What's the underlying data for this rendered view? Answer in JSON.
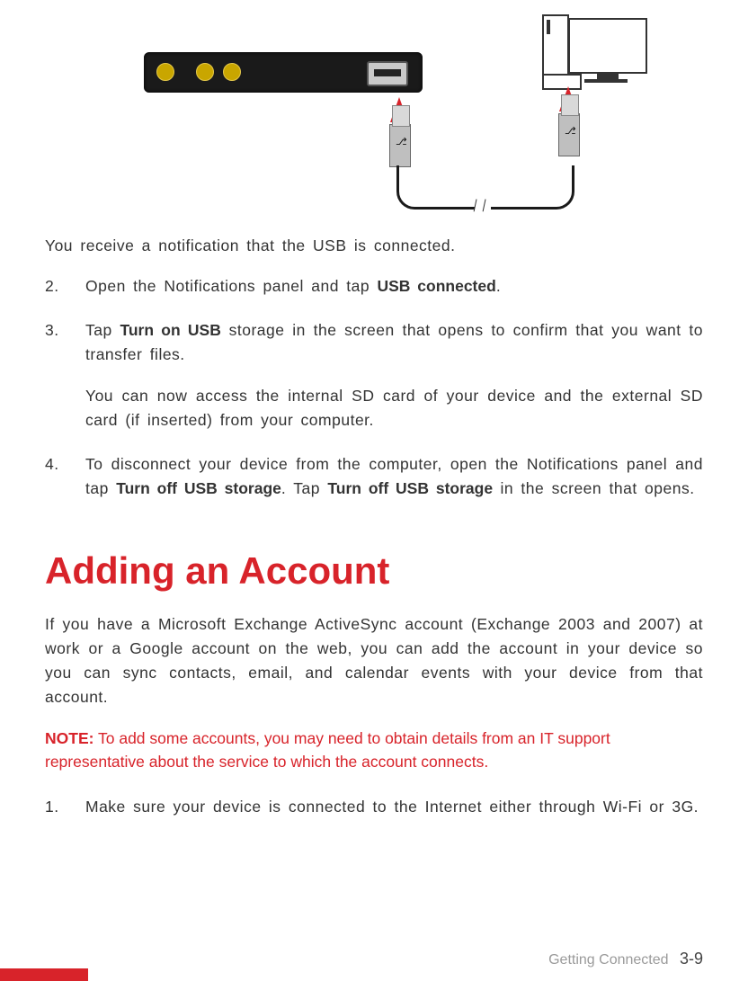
{
  "illustration": {
    "alt": "Device with USB port connected via cable to desktop computer"
  },
  "step1_cont": "You receive a notification that the USB is connected.",
  "steps_a": [
    {
      "num": "2.",
      "pre": "Open the Notifications panel and tap ",
      "bold": "USB connected",
      "post": "."
    },
    {
      "num": "3.",
      "pre": "Tap ",
      "bold": "Turn on USB",
      "post": " storage in the screen that opens to confirm that you want to transfer files.",
      "extra": "You can now access the internal SD card of your device and the external SD card (if inserted) from your computer."
    },
    {
      "num": "4.",
      "pre": "To disconnect your device from the computer, open the Notifications panel and tap ",
      "bold": "Turn off USB storage",
      "mid": ". Tap ",
      "bold2": "Turn off USB storage",
      "post": " in the screen that opens."
    }
  ],
  "heading": "Adding an Account",
  "intro": "If you have a Microsoft Exchange ActiveSync account (Exchange 2003 and 2007) at work or a Google account on the web, you can add the account in your device so you can sync contacts, email, and calendar events with your device from that account.",
  "note": {
    "label": "NOTE:",
    "text": " To add some accounts, you may need to obtain details from an IT support representative about the service to which the account connects."
  },
  "steps_b": [
    {
      "num": "1.",
      "text": "Make sure your device is connected to the Internet either through Wi-Fi or 3G."
    }
  ],
  "footer": {
    "section": "Getting Connected",
    "page": "3-9"
  }
}
